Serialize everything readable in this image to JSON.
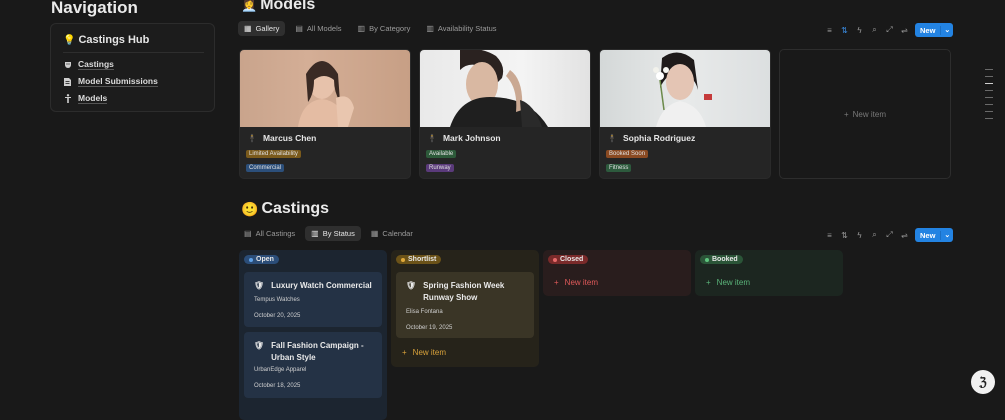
{
  "navigation": {
    "title": "Navigation",
    "hub": "Castings Hub",
    "items": [
      {
        "label": "Castings",
        "icon": "mask-icon"
      },
      {
        "label": "Model Submissions",
        "icon": "document-icon"
      },
      {
        "label": "Models",
        "icon": "person-icon"
      }
    ]
  },
  "models": {
    "title": "Models",
    "tabs": [
      {
        "label": "Gallery",
        "active": true
      },
      {
        "label": "All Models",
        "active": false
      },
      {
        "label": "By Category",
        "active": false
      },
      {
        "label": "Availability Status",
        "active": false
      }
    ],
    "new_label": "New",
    "cards": [
      {
        "name": "Marcus Chen",
        "tags": [
          "Limited Availability",
          "Commercial"
        ]
      },
      {
        "name": "Mark Johnson",
        "tags": [
          "Available",
          "Runway"
        ]
      },
      {
        "name": "Sophia Rodriguez",
        "tags": [
          "Booked Soon",
          "Fitness"
        ]
      }
    ],
    "new_item": "New item"
  },
  "castings": {
    "title": "Castings",
    "tabs": [
      {
        "label": "All Castings",
        "active": false
      },
      {
        "label": "By Status",
        "active": true
      },
      {
        "label": "Calendar",
        "active": false
      }
    ],
    "new_label": "New",
    "columns": [
      {
        "status": "Open",
        "cards": [
          {
            "title": "Luxury Watch Commercial",
            "client": "Tempus Watches",
            "date": "October 20, 2025"
          },
          {
            "title": "Fall Fashion Campaign - Urban Style",
            "client": "UrbanEdge Apparel",
            "date": "October 18, 2025"
          }
        ]
      },
      {
        "status": "Shortlist",
        "cards": [
          {
            "title": "Spring Fashion Week Runway Show",
            "client": "Elisa Fontana",
            "date": "October 19, 2025"
          }
        ],
        "new_item": "New item"
      },
      {
        "status": "Closed",
        "cards": [],
        "new_item": "New item"
      },
      {
        "status": "Booked",
        "cards": [],
        "new_item": "New item"
      }
    ]
  },
  "colors": {
    "accent": "#2383e2",
    "open": "#2e5b8c",
    "shortlist": "#7a5c1a",
    "closed": "#8a2d2d",
    "booked": "#2d5a3d"
  }
}
